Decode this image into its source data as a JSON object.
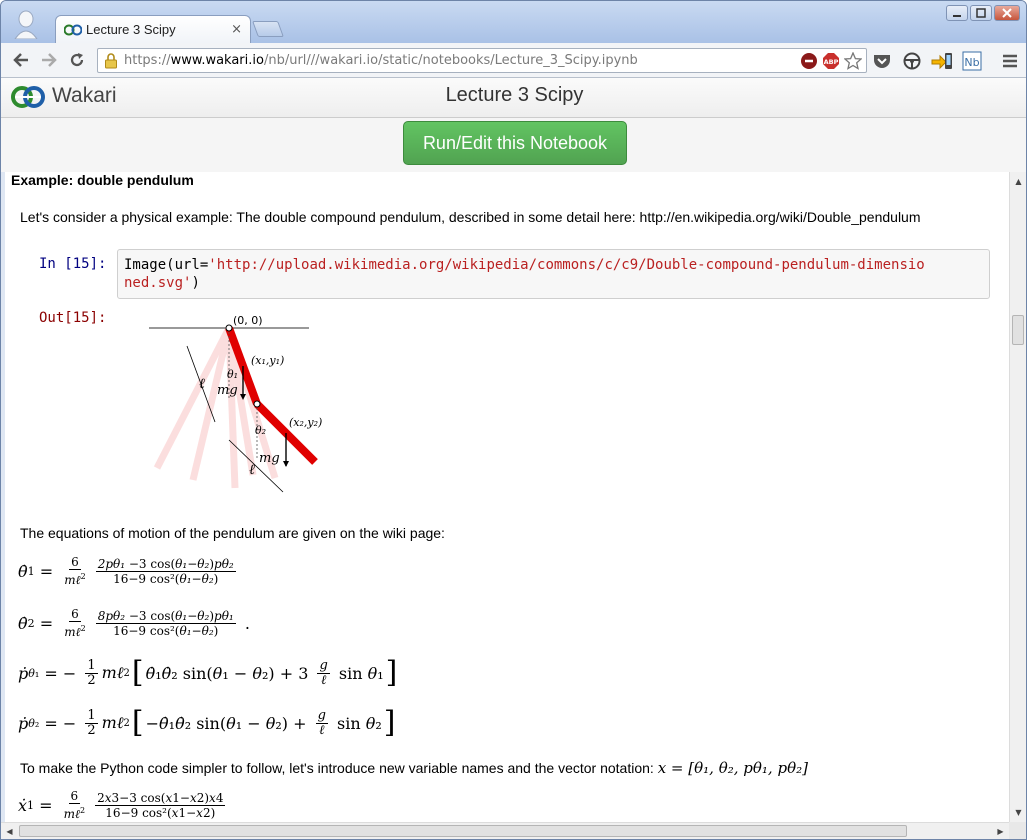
{
  "browser": {
    "tab_title": "Lecture 3 Scipy",
    "tab_close": "×",
    "url_scheme": "https://",
    "url_host": "www.wakari.io",
    "url_path": "/nb/url///wakari.io/static/notebooks/Lecture_3_Scipy.ipynb"
  },
  "header": {
    "brand": "Wakari",
    "notebook_title": "Lecture 3 Scipy",
    "run_button": "Run/Edit this Notebook"
  },
  "notebook": {
    "heading": "Example: double pendulum",
    "intro": "Let's consider a physical example: The double compound pendulum, described in some detail here: http://en.wikipedia.org/wiki/Double_pendulum",
    "in_prompt": "In [15]:",
    "out_prompt": "Out[15]:",
    "code_prefix": "Image(url=",
    "code_string_line1": "'http://upload.wikimedia.org/wikipedia/commons/c/c9/Double-compound-pendulum-dimensio",
    "code_string_line2": "ned.svg'",
    "code_suffix": ")",
    "figure_labels": {
      "origin": "(0, 0)",
      "p1": "(x₁,y₁)",
      "p2": "(x₂,y₂)",
      "theta1": "θ₁",
      "theta2": "θ₂",
      "mg": "mg",
      "ell": "ℓ"
    },
    "equations_intro": "The equations of motion of the pendulum are given on the wiki page:",
    "variables_intro": "To make the Python code simpler to follow, let's introduce new variable names and the vector notation:",
    "vector_notation": "x = [θ₁, θ₂, pθ₁, pθ₂]"
  },
  "colors": {
    "run_button": "#5bb75b",
    "in_prompt": "#000080",
    "out_prompt": "#8b0000",
    "code_string": "#ba2121",
    "pendulum_rod": "#e00000"
  }
}
